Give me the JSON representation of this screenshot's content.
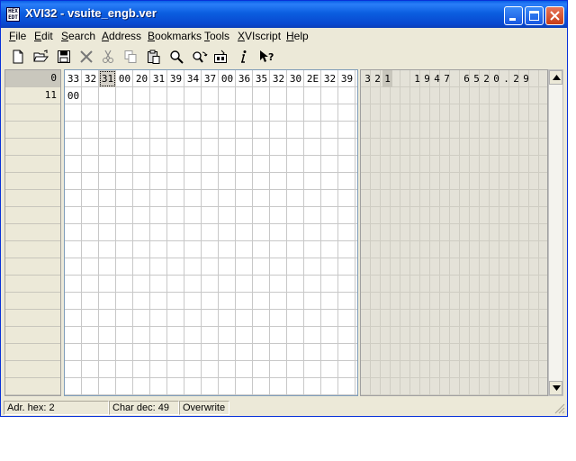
{
  "window": {
    "title": "XVI32 - vsuite_engb.ver",
    "icon_glyph_top": "HEX",
    "icon_glyph_bottom": "EDT"
  },
  "menu": [
    {
      "label": "File",
      "accel": "F",
      "rest": "ile"
    },
    {
      "label": "Edit",
      "accel": "E",
      "rest": "dit"
    },
    {
      "label": "Search",
      "accel": "S",
      "rest": "earch"
    },
    {
      "label": "Address",
      "accel": "A",
      "rest": "ddress"
    },
    {
      "label": "Bookmarks",
      "accel": "B",
      "rest": "ookmarks"
    },
    {
      "label": "Tools",
      "accel": "T",
      "rest": "ools"
    },
    {
      "label": "XVIscript",
      "accel": "X",
      "rest": "VIscript"
    },
    {
      "label": "Help",
      "accel": "H",
      "rest": "elp"
    }
  ],
  "toolbar": [
    "new-file-icon",
    "open-folder-icon",
    "save-icon",
    "delete-icon",
    "cut-icon",
    "copy-icon",
    "paste-icon",
    "find-icon",
    "replace-icon",
    "properties-icon",
    "info-icon",
    "context-help-icon"
  ],
  "address_rows": [
    "0",
    "11"
  ],
  "hex_rows": [
    [
      "33",
      "32",
      "31",
      "00",
      "20",
      "31",
      "39",
      "34",
      "37",
      "00",
      "36",
      "35",
      "32",
      "30",
      "2E",
      "32",
      "39"
    ],
    [
      "00"
    ]
  ],
  "char_rows": [
    [
      "3",
      "2",
      "1",
      " ",
      " ",
      "1",
      "9",
      "4",
      "7",
      " ",
      "6",
      "5",
      "2",
      "0",
      ".",
      "2",
      "9"
    ]
  ],
  "selection": {
    "row": 0,
    "col": 2
  },
  "status": {
    "address": "Adr. hex: 2",
    "char": "Char dec: 49",
    "mode": "Overwrite"
  },
  "colors": {
    "titlebar": "#0a5fe6",
    "close_button": "#c73c16",
    "selection": "#d4d0c8"
  }
}
